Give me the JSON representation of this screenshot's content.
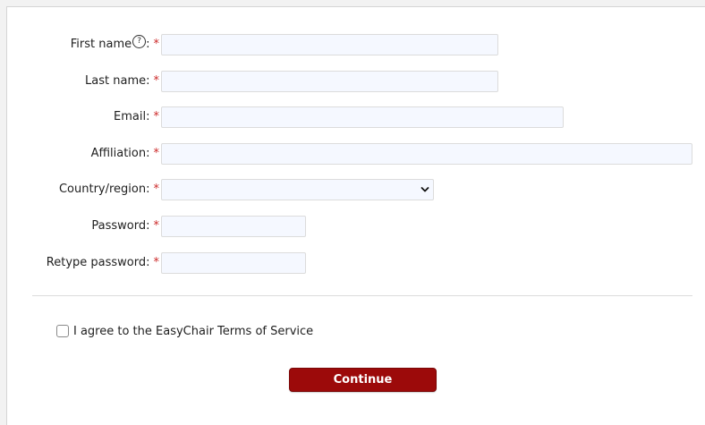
{
  "form": {
    "required_marker": "*",
    "first_name": {
      "label": "First name",
      "help_glyph": "?",
      "colon": ":",
      "value": ""
    },
    "last_name": {
      "label": "Last name:",
      "value": ""
    },
    "email": {
      "label": "Email:",
      "value": ""
    },
    "affiliation": {
      "label": "Affiliation:",
      "value": ""
    },
    "country": {
      "label": "Country/region:",
      "selected": ""
    },
    "password": {
      "label": "Password:",
      "value": ""
    },
    "retype_password": {
      "label": "Retype password:",
      "value": ""
    },
    "terms": {
      "label": "I agree to the EasyChair Terms of Service",
      "checked": false
    },
    "continue_label": "Continue"
  },
  "colors": {
    "required": "#cc2a2a",
    "button": "#9c0a0a",
    "field_bg": "#f5f8ff"
  }
}
